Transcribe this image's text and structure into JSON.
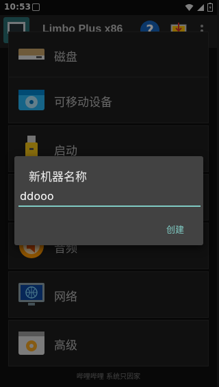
{
  "status": {
    "time": "10:53"
  },
  "appbar": {
    "title": "Limbo Plus x86",
    "help_glyph": "?"
  },
  "list": {
    "items": [
      {
        "label": "磁盘",
        "icon": "disk-drive-icon"
      },
      {
        "label": "可移动设备",
        "icon": "removable-disc-icon"
      },
      {
        "label": "启动",
        "icon": "usb-boot-icon"
      },
      {
        "label": "",
        "icon": "hidden-row-icon"
      },
      {
        "label": "音频",
        "icon": "audio-speaker-icon"
      },
      {
        "label": "网络",
        "icon": "network-globe-icon"
      },
      {
        "label": "高级",
        "icon": "advanced-gear-icon"
      }
    ]
  },
  "footer": {
    "text": "哔哩哔哩 系统只因家"
  },
  "dialog": {
    "title": "新机器名称",
    "input_value": "ddooo",
    "create_label": "创建"
  },
  "colors": {
    "accent": "#80cbc4",
    "help_blue": "#1565c0"
  }
}
